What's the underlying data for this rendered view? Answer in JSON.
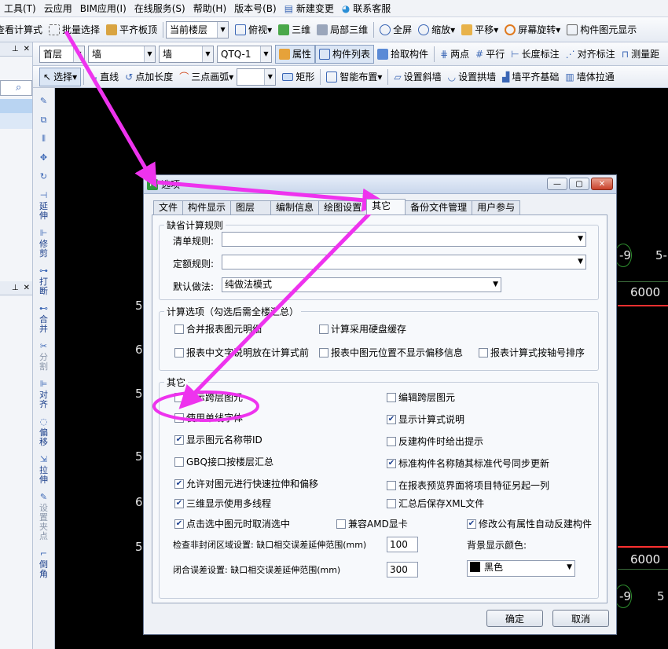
{
  "menubar": {
    "items": [
      "工具(T)",
      "云应用",
      "BIM应用(I)",
      "在线服务(S)",
      "帮助(H)",
      "版本号(B)",
      "新建变更",
      "联系客服"
    ]
  },
  "toolbar1": {
    "view_calc": "查看计算式",
    "batch_select": "批量选择",
    "align_slab": "平齐板顶",
    "floor_combo": "当前楼层",
    "top_view": "俯视",
    "three_d": "三维",
    "local_3d": "局部三维",
    "fullscreen": "全屏",
    "zoom": "缩放",
    "pan": "平移",
    "rotate": "屏幕旋转",
    "component_display": "构件图元显示"
  },
  "toolbar2": {
    "layer": "首层",
    "type1": "墙",
    "type2": "墙",
    "component": "QTQ-1",
    "properties": "属性",
    "component_list": "构件列表",
    "pick": "拾取构件",
    "two_points": "两点",
    "parallel": "平行",
    "length_dim": "长度标注",
    "align_dim": "对齐标注",
    "measure": "测量距"
  },
  "toolbar3": {
    "select": "选择",
    "line": "直线",
    "point_len": "点加长度",
    "arc3": "三点画弧",
    "rect": "矩形",
    "smart_layout": "智能布置",
    "slant_wall": "设置斜墙",
    "arch_wall": "设置拱墙",
    "wall_align_base": "墙平齐基础",
    "wall_pull": "墙体拉通"
  },
  "vtools": [
    "延伸",
    "修剪",
    "打断",
    "合并",
    "分割",
    "对齐",
    "偏移",
    "拉伸",
    "设置夹点",
    "倒角"
  ],
  "canvas": {
    "axis_left": [
      "5",
      "6",
      "5",
      "6",
      "5",
      "5"
    ],
    "axis_right_top": [
      "-9",
      "5-"
    ],
    "axis_right_bottom": [
      "-9",
      "5"
    ],
    "dim_top": "6000",
    "dim_bottom": "6000"
  },
  "dialog": {
    "title": "选项",
    "tabs": [
      "文件",
      "构件显示",
      "图层",
      "编制信息",
      "绘图设置",
      "其它",
      "备份文件管理",
      "用户参与"
    ],
    "active_tab": "其它",
    "group_default": {
      "legend": "缺省计算规则",
      "list_rule_label": "清单规则:",
      "list_rule_value": "",
      "quota_rule_label": "定额规则:",
      "quota_rule_value": "",
      "default_method_label": "默认做法:",
      "default_method_value": "纯做法模式"
    },
    "group_calc": {
      "legend": "计算选项（勾选后需全楼汇总）",
      "options": [
        {
          "label": "合并报表图元明细",
          "checked": false
        },
        {
          "label": "计算采用硬盘缓存",
          "checked": false
        },
        {
          "label": "报表中文字说明放在计算式前",
          "checked": false
        },
        {
          "label": "报表中图元位置不显示偏移信息",
          "checked": false
        },
        {
          "label": "报表计算式按轴号排序",
          "checked": false
        }
      ]
    },
    "group_other": {
      "legend": "其它",
      "left": [
        {
          "label": "显示跨层图元",
          "checked": false
        },
        {
          "label": "使用单线字体",
          "checked": false
        },
        {
          "label": "显示图元名称带ID",
          "checked": true
        },
        {
          "label": "GBQ接口按楼层汇总",
          "checked": false
        },
        {
          "label": "允许对图元进行快速拉伸和偏移",
          "checked": true
        },
        {
          "label": "三维显示使用多线程",
          "checked": true
        },
        {
          "label": "点击选中图元时取消选中",
          "checked": true
        }
      ],
      "right": [
        {
          "label": "编辑跨层图元",
          "checked": false
        },
        {
          "label": "显示计算式说明",
          "checked": true
        },
        {
          "label": "反建构件时给出提示",
          "checked": false
        },
        {
          "label": "标准构件名称随其标准代号同步更新",
          "checked": true
        },
        {
          "label": "在报表预览界面将项目特征另起一列",
          "checked": false
        },
        {
          "label": "汇总后保存XML文件",
          "checked": false
        }
      ],
      "amd": {
        "label": "兼容AMD显卡",
        "checked": false
      },
      "auto_rebuild": {
        "label": "修改公有属性自动反建构件",
        "checked": true
      },
      "gap_check_label": "检查非封闭区域设置: 缺口相交误差延伸范围(mm)",
      "gap_check_value": "100",
      "close_err_label": "闭合误差设置: 缺口相交误差延伸范围(mm)",
      "close_err_value": "300",
      "bg_color_label": "背景显示颜色:",
      "bg_color_value": "黑色"
    },
    "ok": "确定",
    "cancel": "取消"
  },
  "colors": {
    "annotation": "#ee33ee",
    "dim_line": "#ff3030",
    "axis_circle": "#2f8f2f"
  }
}
